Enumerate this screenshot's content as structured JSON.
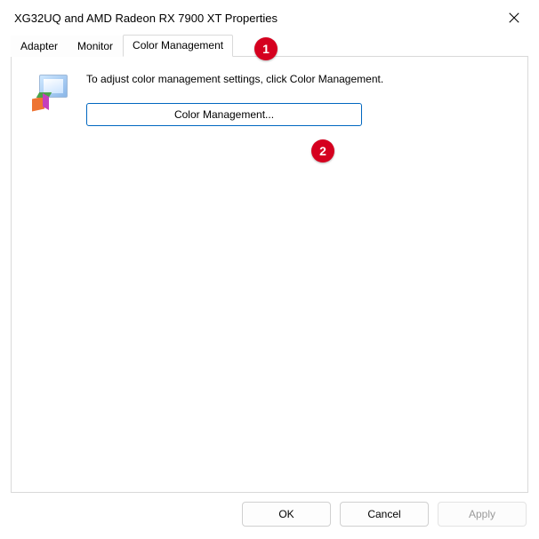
{
  "title": "XG32UQ and AMD Radeon RX 7900 XT Properties",
  "tabs": {
    "adapter": "Adapter",
    "monitor": "Monitor",
    "color": "Color Management"
  },
  "content": {
    "description": "To adjust color management settings, click Color Management.",
    "button": "Color Management..."
  },
  "footer": {
    "ok": "OK",
    "cancel": "Cancel",
    "apply": "Apply"
  },
  "callouts": {
    "c1": "1",
    "c2": "2"
  }
}
